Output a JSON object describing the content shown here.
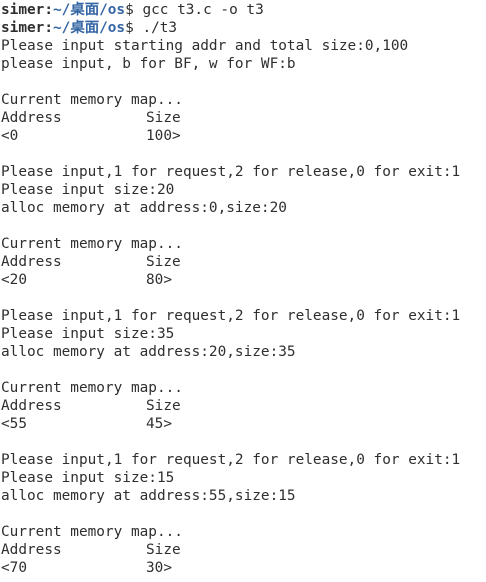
{
  "prompt1": {
    "user": "simer",
    "sep": ":",
    "path": "~/桌面/os",
    "sym": "$ ",
    "cmd": "gcc t3.c -o t3"
  },
  "prompt2": {
    "user": "simer",
    "sep": ":",
    "path": "~/桌面/os",
    "sym": "$ ",
    "cmd": "./t3"
  },
  "intro": [
    "Please input starting addr and total size:0,100",
    "please input, b for BF, w for WF:b"
  ],
  "map_heading": "Current memory map...",
  "col_address": "Address",
  "col_size": "Size",
  "menu_prompt": "Please input,1 for request,2 for release,0 for exit:1",
  "maps": [
    {
      "addr": "<0",
      "size": "100>"
    },
    {
      "addr": "<20",
      "size": "80>"
    },
    {
      "addr": "<55",
      "size": "45>"
    },
    {
      "addr": "<70",
      "size": "30>"
    }
  ],
  "requests": [
    {
      "size_line": "Please input size:20",
      "alloc_line": "alloc memory at address:0,size:20"
    },
    {
      "size_line": "Please input size:35",
      "alloc_line": "alloc memory at address:20,size:35"
    },
    {
      "size_line": "Please input size:15",
      "alloc_line": "alloc memory at address:55,size:15"
    }
  ]
}
